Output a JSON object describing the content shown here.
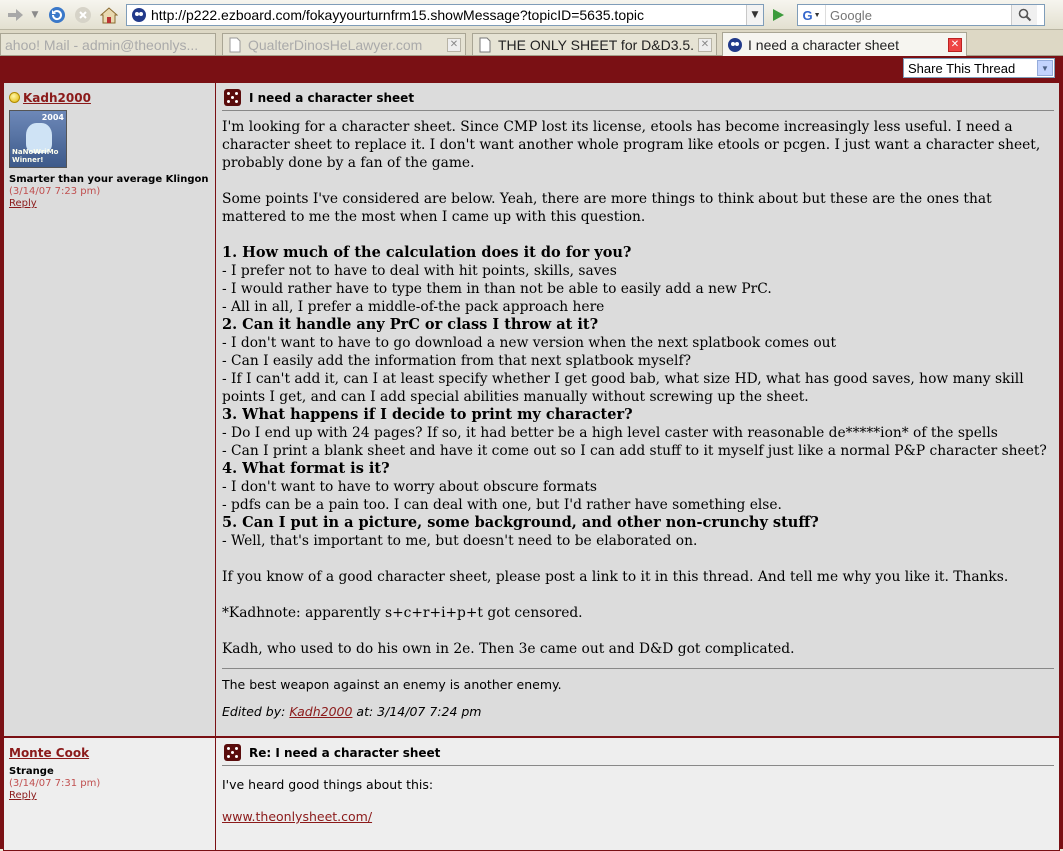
{
  "browser": {
    "url": "http://p222.ezboard.com/fokayyourturnfrm15.showMessage?topicID=5635.topic",
    "search_engine_label": "G",
    "search_placeholder": "Google",
    "tabs": [
      {
        "label": "ahoo! Mail - admin@theonlys..."
      },
      {
        "label": "QualterDinosHeLawyer.com"
      },
      {
        "label": "THE ONLY SHEET for D&D3.5..."
      },
      {
        "label": "I need a character sheet"
      }
    ]
  },
  "page": {
    "share_label": "Share This Thread",
    "posts": [
      {
        "username": "Kadh2000",
        "avatar_year": "2004",
        "avatar_badge": "NaNoWriMo Winner!",
        "user_title": "Smarter than your average Klingon",
        "date": "(3/14/07 7:23 pm)",
        "reply_label": "Reply",
        "subject": "I need a character sheet",
        "paragraphs": [
          "I'm looking for a character sheet. Since CMP lost its license, etools has become increasingly less useful. I need a character sheet to replace it. I don't want another whole program like etools or pcgen. I just want a character sheet, probably done by a fan of the game.",
          "Some points I've considered are below. Yeah, there are more things to think about but these are the ones that mattered to me the most when I came up with this question."
        ],
        "q1": "1. How much of the calculation does it do for you?",
        "q1_lines": "- I prefer not to have to deal with hit points, skills, saves\n- I would rather have to type them in than not be able to easily add a new PrC.\n- All in all, I prefer a middle-of-the pack approach here",
        "q2": "2. Can it handle any PrC or class I throw at it?",
        "q2_lines": "- I don't want to have to go download a new version when the next splatbook comes out\n- Can I easily add the information from that next splatbook myself?\n- If I can't add it, can I at least specify whether I get good bab, what size HD, what has good saves, how many skill points I get, and can I add special abilities manually without screwing up the sheet.",
        "q3": "3. What happens if I decide to print my character?",
        "q3_lines": "- Do I end up with 24 pages? If so, it had better be a high level caster with reasonable de*****ion* of the spells\n- Can I print a blank sheet and have it come out so I can add stuff to it myself just like a normal P&P character sheet?",
        "q4": "4. What format is it?",
        "q4_lines": "- I don't want to have to worry about obscure formats\n- pdfs can be a pain too. I can deal with one, but I'd rather have something else.",
        "q5": "5. Can I put in a picture, some background, and other non-crunchy stuff?",
        "q5_lines": "- Well, that's important to me, but doesn't need to be elaborated on.",
        "closing": "If you know of a good character sheet, please post a link to it in this thread. And tell me why you like it. Thanks.",
        "note": "*Kadhnote: apparently s+c+r+i+p+t got censored.",
        "signoff": "Kadh, who used to do his own in 2e. Then 3e came out and D&D got complicated.",
        "signature": "The best weapon against an enemy is another enemy.",
        "edited_prefix": "Edited by:",
        "edited_user": "Kadh2000",
        "edited_at": "at: 3/14/07 7:24 pm"
      },
      {
        "username": "Monte Cook",
        "user_title": "Strange",
        "date": "(3/14/07 7:31 pm)",
        "reply_label": "Reply",
        "subject": "Re: I need a character sheet",
        "text": "I've heard good things about this:",
        "link": "www.theonlysheet.com/"
      }
    ]
  }
}
